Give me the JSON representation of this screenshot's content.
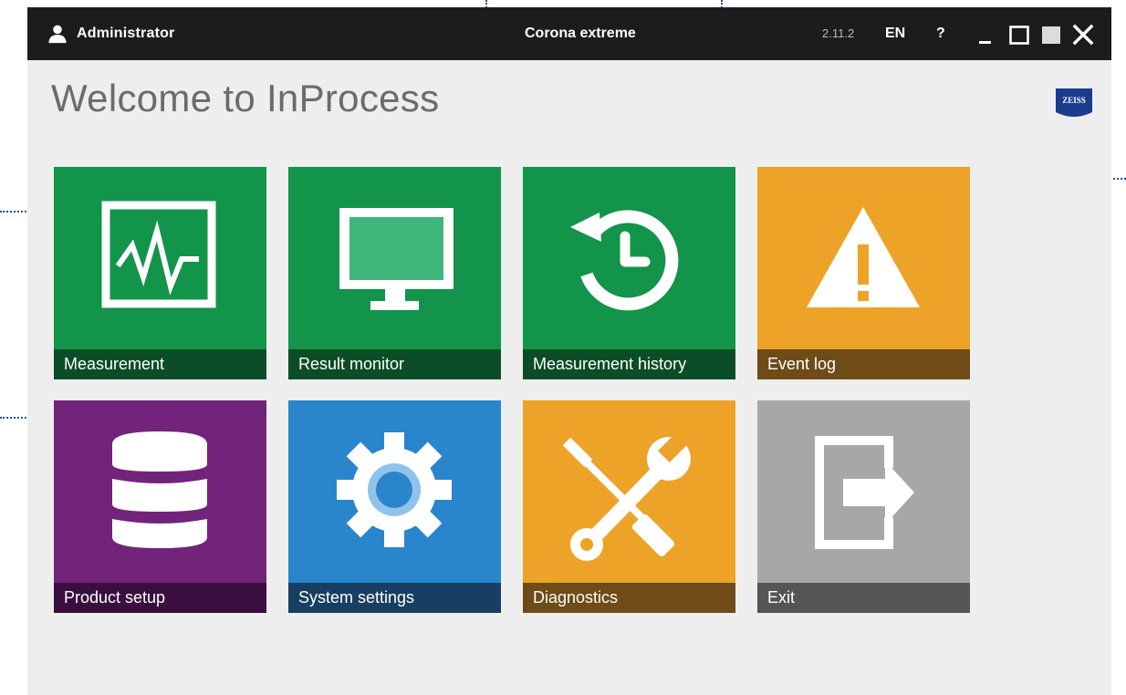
{
  "titlebar": {
    "user": "Administrator",
    "title": "Corona extreme",
    "version": "2.11.2",
    "language": "EN",
    "help": "?"
  },
  "welcome": "Welcome to InProcess",
  "logo": {
    "text": "ZEISS",
    "color": "#1a3c8f"
  },
  "tiles": [
    {
      "label": "Measurement",
      "color": "#12944a",
      "label_bg": "#0b4d26",
      "icon": "chart-icon"
    },
    {
      "label": "Result monitor",
      "color": "#12944a",
      "label_bg": "#0b4d26",
      "icon": "monitor-icon"
    },
    {
      "label": "Measurement history",
      "color": "#12944a",
      "label_bg": "#0b4d26",
      "icon": "history-icon"
    },
    {
      "label": "Event log",
      "color": "#eda327",
      "label_bg": "#6e4b17",
      "icon": "warning-icon"
    },
    {
      "label": "Product setup",
      "color": "#72237a",
      "label_bg": "#3a0f3f",
      "icon": "database-icon"
    },
    {
      "label": "System settings",
      "color": "#2a86cc",
      "label_bg": "#173f61",
      "icon": "gear-icon"
    },
    {
      "label": "Diagnostics",
      "color": "#eda327",
      "label_bg": "#6e4b17",
      "icon": "tools-icon"
    },
    {
      "label": "Exit",
      "color": "#a7a7a7",
      "label_bg": "#555555",
      "icon": "exit-icon"
    }
  ],
  "window_controls": [
    "minimize-icon",
    "restore-icon",
    "maximize-icon",
    "close-icon"
  ]
}
